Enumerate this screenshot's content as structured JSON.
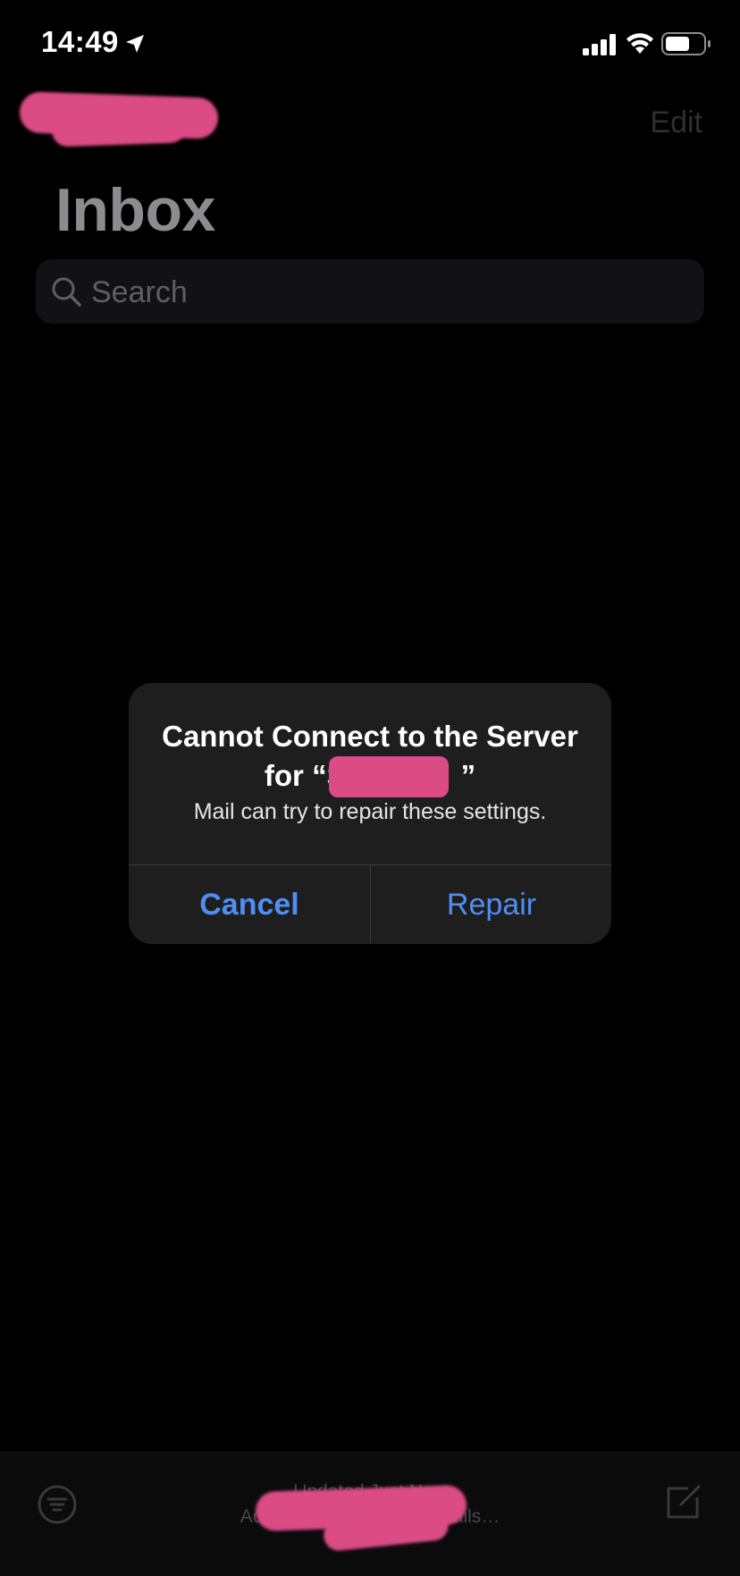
{
  "status_bar": {
    "time": "14:49",
    "icons": [
      "location-arrow-icon",
      "cellular-signal-icon",
      "wifi-icon",
      "battery-icon"
    ]
  },
  "nav": {
    "back_icon": "chevron-left-icon",
    "edit_label": "Edit"
  },
  "page": {
    "title": "Inbox"
  },
  "search": {
    "icon": "search-icon",
    "placeholder": "Search"
  },
  "toolbar": {
    "filter_icon": "filter-icon",
    "compose_icon": "compose-icon",
    "status_line_1": "Updated Just Now",
    "status_line_2": "Account Erre                 etails…"
  },
  "alert": {
    "title_line_1": "Cannot Connect to the Server",
    "title_line_2_prefix": "for “S",
    "title_line_2_suffix": "”",
    "message": "Mail can try to repair these settings.",
    "cancel_label": "Cancel",
    "repair_label": "Repair"
  },
  "colors": {
    "background": "#000000",
    "alert_background": "#1e1e1f",
    "accent": "#4f8ef2",
    "redaction": "#db4b84"
  }
}
